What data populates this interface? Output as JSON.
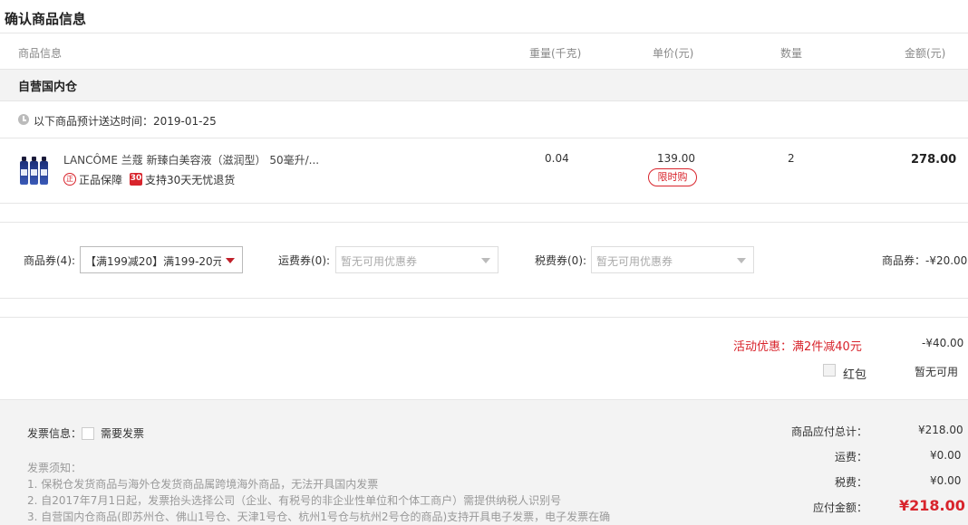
{
  "page": {
    "title": "确认商品信息"
  },
  "columns": {
    "product": "商品信息",
    "weight": "重量(千克)",
    "unit_price": "单价(元)",
    "quantity": "数量",
    "amount": "金额(元)"
  },
  "warehouse": {
    "title": "自营国内仓",
    "delivery_text": "以下商品预计送达时间：2019-01-25"
  },
  "item": {
    "name": "LANCÔME 兰蔻 新臻白美容液（滋润型） 50毫升/...",
    "tag_genuine_icon": "正",
    "tag_genuine": "正品保障",
    "tag_return_icon": "30",
    "tag_return": "支持30天无忧退货",
    "weight": "0.04",
    "unit_price": "139.00",
    "limit_tag": "限时购",
    "quantity": "2",
    "amount": "278.00"
  },
  "coupons": {
    "goods_label": "商品券(4):",
    "goods_value": "【满199减20】满199-20元...",
    "shipping_label": "运费券(0):",
    "shipping_placeholder": "暂无可用优惠券",
    "tax_label": "税费券(0):",
    "tax_placeholder": "暂无可用优惠券",
    "goods_discount": "商品券：-¥20.00"
  },
  "promotion": {
    "label": "活动优惠：满2件减40元",
    "value": "-¥40.00",
    "red_packet_label": "红包",
    "red_packet_value": "暂无可用"
  },
  "invoice": {
    "label": "发票信息：",
    "need_label": "需要发票",
    "notice_title": "发票须知：",
    "notice_1": "1. 保税仓发货商品与海外仓发货商品属跨境海外商品，无法开具国内发票",
    "notice_2": "2. 自2017年7月1日起，发票抬头选择公司（企业、有税号的非企业性单位和个体工商户）需提供纳税人识别号",
    "notice_3": "3. 自营国内仓商品(即苏州仓、佛山1号仓、天津1号仓、杭州1号仓与杭州2号仓的商品)支持开具电子发票，电子发票在确"
  },
  "summary": {
    "goods_total_label": "商品应付总计：",
    "goods_total_value": "¥218.00",
    "shipping_label": "运费：",
    "shipping_value": "¥0.00",
    "tax_label": "税费：",
    "tax_value": "¥0.00",
    "payable_label": "应付金额：",
    "payable_value": "¥218.00"
  },
  "colors": {
    "accent": "#d8242c",
    "bg_gray": "#f3f3f3",
    "border": "#e6e6e6"
  }
}
